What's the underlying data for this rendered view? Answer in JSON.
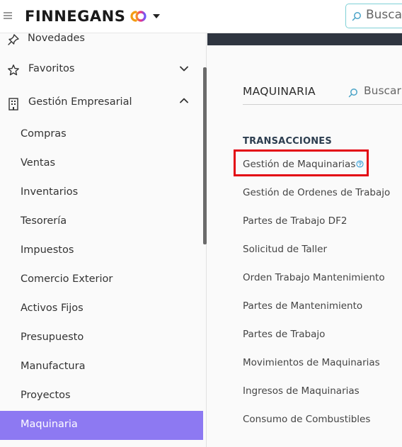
{
  "header": {
    "brand": "FINNEGANS",
    "search_placeholder": "Buscar"
  },
  "sidebar": {
    "top_items": [
      {
        "label": "Novedades",
        "icon": "pin-icon"
      },
      {
        "label": "Favoritos",
        "icon": "star-icon"
      },
      {
        "label": "Gestión Empresarial",
        "icon": "building-icon"
      }
    ],
    "sub_items": [
      {
        "label": "Compras"
      },
      {
        "label": "Ventas"
      },
      {
        "label": "Inventarios"
      },
      {
        "label": "Tesorería"
      },
      {
        "label": "Impuestos"
      },
      {
        "label": "Comercio Exterior"
      },
      {
        "label": "Activos Fijos"
      },
      {
        "label": "Presupuesto"
      },
      {
        "label": "Manufactura"
      },
      {
        "label": "Proyectos"
      },
      {
        "label": "Maquinaria"
      }
    ],
    "active_item": "Maquinaria"
  },
  "main": {
    "title": "MAQUINARIA",
    "search_placeholder": "Buscar",
    "group_title": "TRANSACCIONES",
    "links": [
      {
        "label": "Gestión de Maquinarias"
      },
      {
        "label": "Gestión de Ordenes de Trabajo"
      },
      {
        "label": "Partes de Trabajo DF2"
      },
      {
        "label": "Solicitud de Taller"
      },
      {
        "label": "Orden Trabajo Mantenimiento"
      },
      {
        "label": "Partes de Mantenimiento"
      },
      {
        "label": "Partes de Trabajo"
      },
      {
        "label": "Movimientos de Maquinarias"
      },
      {
        "label": "Ingresos de Maquinarias"
      },
      {
        "label": "Consumo de Combustibles"
      }
    ]
  },
  "colors": {
    "active_bg": "#8d79f2",
    "highlight_border": "#e30613",
    "search_border": "#7fd0d6",
    "dark_band": "#2f3540"
  }
}
